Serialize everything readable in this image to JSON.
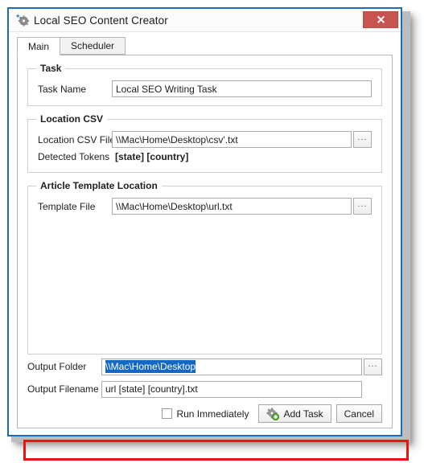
{
  "window": {
    "title": "Local SEO Content Creator",
    "title_icon": "gear-sparkle-icon",
    "close_label": "X",
    "close_color": "#c75450",
    "border_color": "#1b6eb5"
  },
  "tabs": [
    {
      "label": "Main",
      "active": true
    },
    {
      "label": "Scheduler",
      "active": false
    }
  ],
  "groups": {
    "task": {
      "title": "Task",
      "task_name_label": "Task Name",
      "task_name_value": "Local SEO Writing Task"
    },
    "location_csv": {
      "title": "Location CSV",
      "csv_file_label": "Location CSV File",
      "csv_file_value": "\\\\Mac\\Home\\Desktop\\csv'.txt",
      "browse_label": "...",
      "detected_tokens_label": "Detected Tokens",
      "detected_tokens_value": "[state] [country]"
    },
    "article_template": {
      "title": "Article Template Location",
      "template_file_label": "Template File",
      "template_file_value": "\\\\Mac\\Home\\Desktop\\url.txt",
      "browse_label": "..."
    }
  },
  "output": {
    "folder_label": "Output Folder",
    "folder_value": "\\\\Mac\\Home\\Desktop",
    "folder_selected": true,
    "folder_browse_label": "...",
    "filename_label": "Output Filename",
    "filename_value": "url [state] [country].txt",
    "highlight_color": "#ee1111"
  },
  "footer": {
    "run_immediately_label": "Run Immediately",
    "run_immediately_checked": false,
    "add_task_label": "Add Task",
    "add_task_icon": "gear-plus-icon",
    "cancel_label": "Cancel"
  }
}
